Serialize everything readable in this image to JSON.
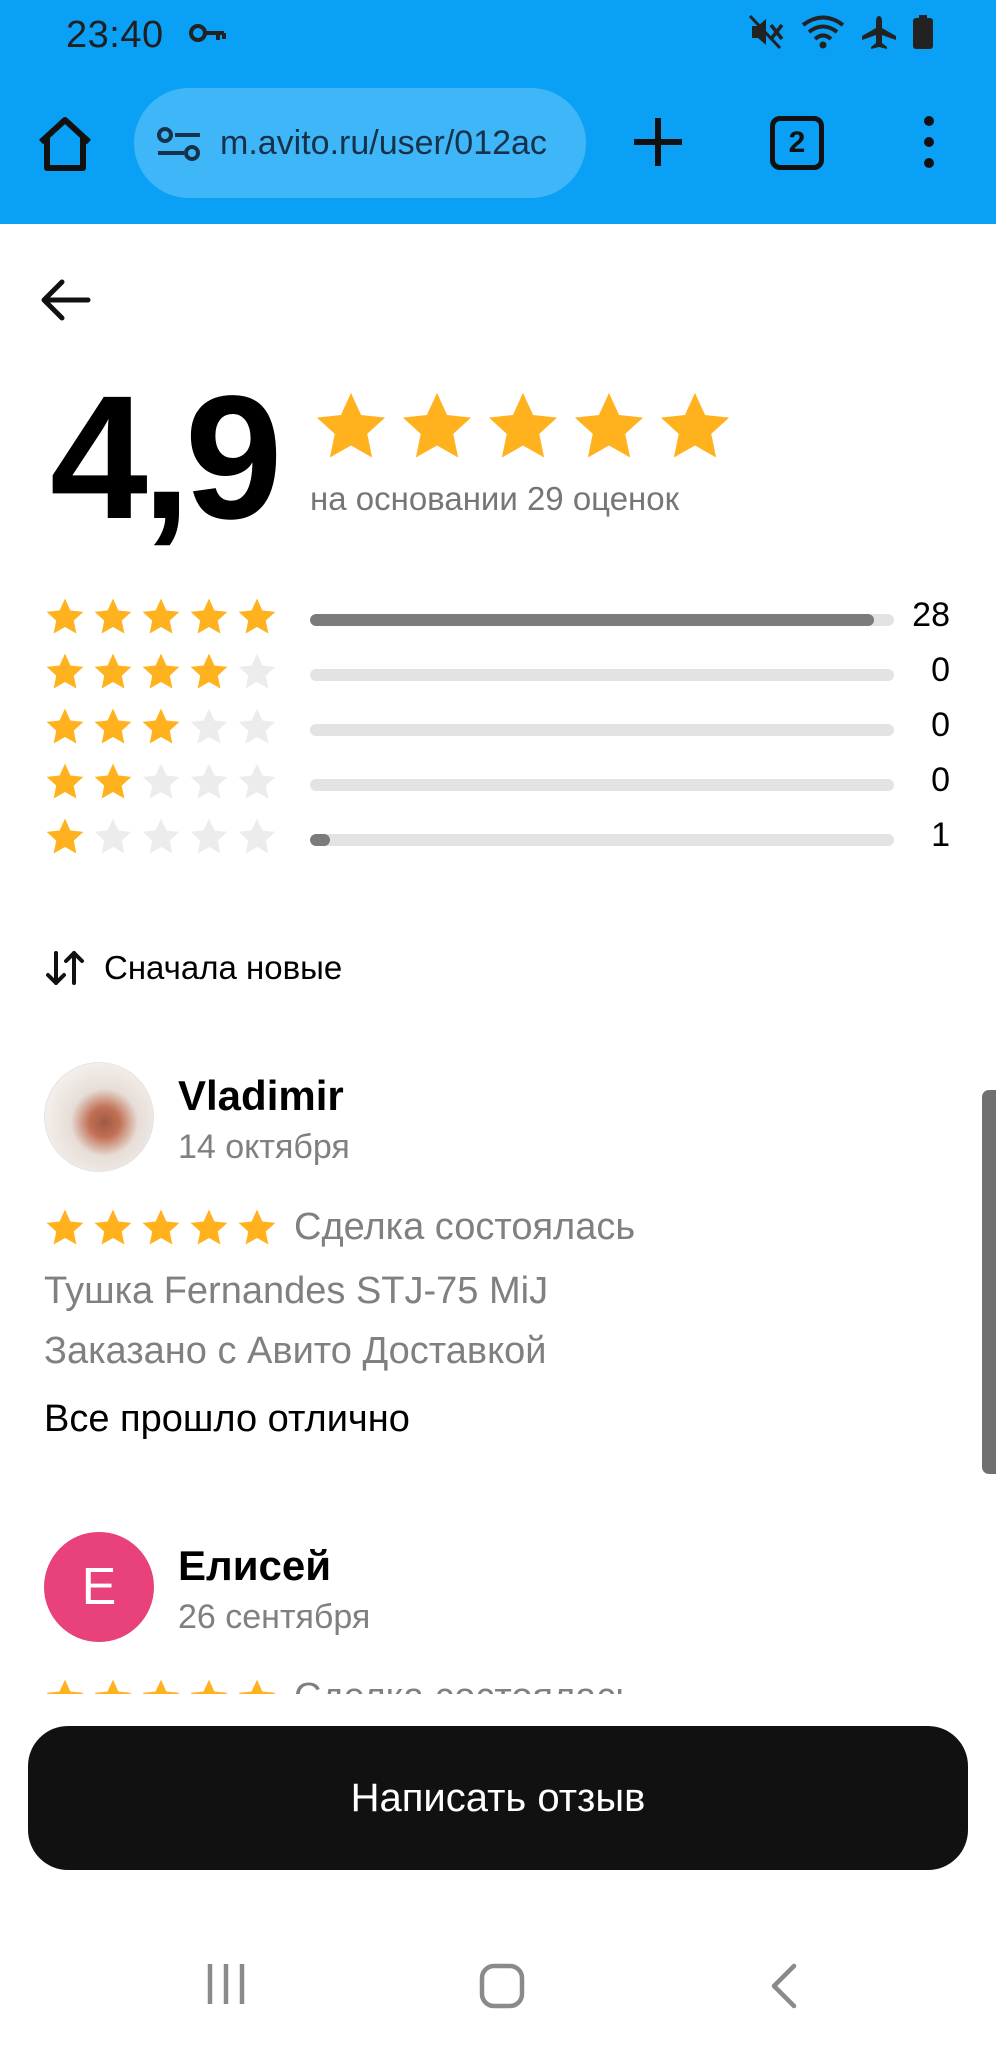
{
  "status_bar": {
    "time": "23:40",
    "icons": [
      "key-icon",
      "mute-icon",
      "wifi-icon",
      "airplane-icon",
      "battery-icon"
    ]
  },
  "browser": {
    "url": "m.avito.ru/user/012ac",
    "tab_count": "2"
  },
  "rating": {
    "score": "4,9",
    "basis": "на основании 29 оценок",
    "stars": 5,
    "star_color": "#ffb21e",
    "distribution": [
      {
        "stars": 5,
        "count": "28",
        "fraction": 0.966
      },
      {
        "stars": 4,
        "count": "0",
        "fraction": 0
      },
      {
        "stars": 3,
        "count": "0",
        "fraction": 0
      },
      {
        "stars": 2,
        "count": "0",
        "fraction": 0
      },
      {
        "stars": 1,
        "count": "1",
        "fraction": 0.034
      }
    ]
  },
  "sort": {
    "label": "Сначала новые"
  },
  "reviews": [
    {
      "author": "Vladimir",
      "date": "14 октября",
      "stars": 5,
      "deal_status": "Сделка состоялась",
      "item": "Тушка Fernandes STJ-75 MiJ",
      "delivery": "Заказано с Авито Доставкой",
      "comment": "Все прошло отлично",
      "avatar": "photo"
    },
    {
      "author": "Елисей",
      "date": "26 сентября",
      "stars": 5,
      "deal_status": "Сделка состоялась",
      "avatar_letter": "Е",
      "avatar_color": "#e8417c"
    }
  ],
  "cta": {
    "label": "Написать отзыв"
  }
}
